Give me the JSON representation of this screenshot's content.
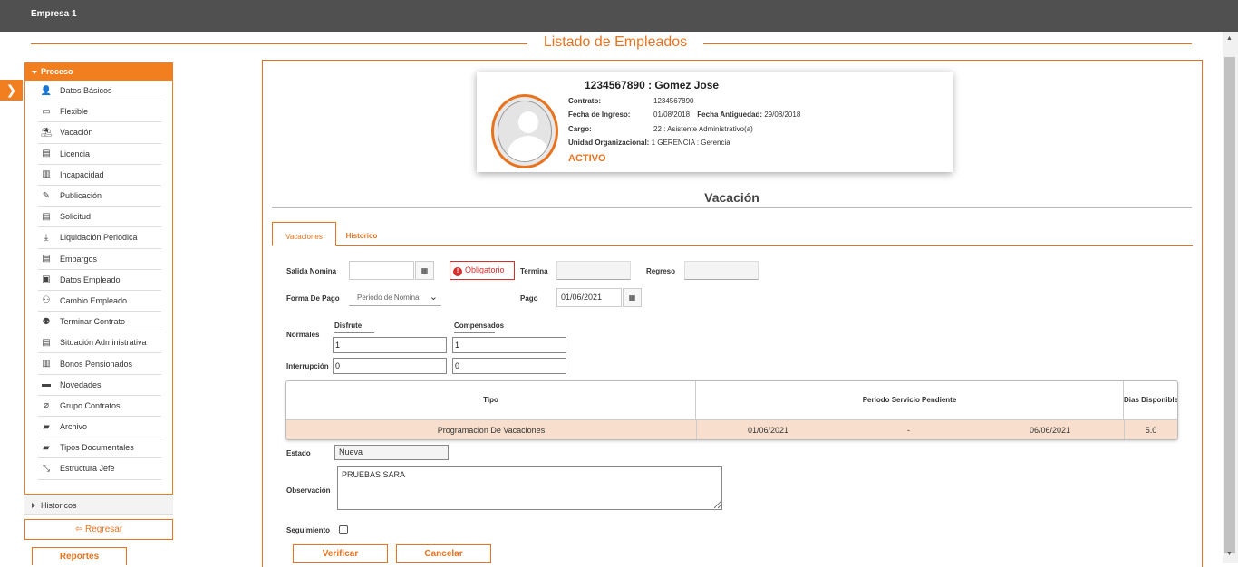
{
  "topbar": {
    "company": "Empresa 1"
  },
  "page": {
    "title": "Listado de Empleados"
  },
  "sidebar": {
    "header": "Proceso",
    "items": [
      {
        "label": "Datos Básicos",
        "icon": "user-icon"
      },
      {
        "label": "Flexible",
        "icon": "money-icon"
      },
      {
        "label": "Vacación",
        "icon": "beach-chair-icon"
      },
      {
        "label": "Licencia",
        "icon": "list-icon"
      },
      {
        "label": "Incapacidad",
        "icon": "book-icon"
      },
      {
        "label": "Publicación",
        "icon": "pencil-icon"
      },
      {
        "label": "Solicitud",
        "icon": "document-icon"
      },
      {
        "label": "Liquidación Periodica",
        "icon": "download-icon"
      },
      {
        "label": "Embargos",
        "icon": "list-icon"
      },
      {
        "label": "Datos Empleado",
        "icon": "id-card-icon"
      },
      {
        "label": "Cambio Empleado",
        "icon": "user-change-icon"
      },
      {
        "label": "Terminar Contrato",
        "icon": "user-remove-icon"
      },
      {
        "label": "Situación Administrativa",
        "icon": "document-icon"
      },
      {
        "label": "Bonos Pensionados",
        "icon": "book-icon"
      },
      {
        "label": "Novedades",
        "icon": "comment-icon"
      },
      {
        "label": "Grupo Contratos",
        "icon": "paperclip-icon"
      },
      {
        "label": "Archivo",
        "icon": "folder-open-icon"
      },
      {
        "label": "Tipos Documentales",
        "icon": "folder-open-icon"
      },
      {
        "label": "Estructura Jefe",
        "icon": "compress-icon"
      }
    ],
    "historicos": "Historicos",
    "regresar": "Regresar",
    "reportes": "Reportes"
  },
  "employee": {
    "title": "1234567890 : Gomez Jose",
    "contrato_label": "Contrato:",
    "contrato": "1234567890",
    "ingreso_label": "Fecha de Ingreso:",
    "ingreso": "01/08/2018",
    "antiguedad_label": "Fecha Antiguedad:",
    "antiguedad": "29/08/2018",
    "cargo_label": "Cargo:",
    "cargo": "22 : Asistente Administrativo(a)",
    "unidad_label": "Unidad Organizacional:",
    "unidad": "1 GERENCIA : Gerencia",
    "status": "ACTIVO"
  },
  "section": {
    "title": "Vacación"
  },
  "tabs": {
    "vacaciones": "Vacaciones",
    "historico": "Historico"
  },
  "form": {
    "salida_label": "Salida Nomina",
    "salida_value": "",
    "obligatorio": "Obligatorio",
    "termina_label": "Termina",
    "termina_value": "",
    "regreso_label": "Regreso",
    "regreso_value": "",
    "forma_pago_label": "Forma De Pago",
    "forma_pago_value": "Periodo de Nomina",
    "pago_label": "Pago",
    "pago_value": "01/06/2021",
    "disfrute_label": "Disfrute",
    "compensados_label": "Compensados",
    "normales_label": "Normales",
    "normales_disfrute": "1",
    "normales_compensados": "1",
    "interrupcion_label": "Interrupción",
    "interrupcion_disfrute": "0",
    "interrupcion_compensados": "0",
    "estado_label": "Estado",
    "estado_value": "Nueva",
    "observacion_label": "Observación",
    "observacion_value": "PRUEBAS SARA",
    "seguimiento_label": "Seguimiento"
  },
  "grid": {
    "headers": {
      "tipo": "Tipo",
      "periodo": "Periodo Servicio Pendiente",
      "dias": "Dias Disponible"
    },
    "row": {
      "tipo": "Programacion De Vacaciones",
      "desde": "01/06/2021",
      "sep": "-",
      "hasta": "06/06/2021",
      "dias": "5.0"
    }
  },
  "buttons": {
    "verificar": "Verificar",
    "cancelar": "Cancelar"
  },
  "colors": {
    "accent": "#e8731f",
    "topbar": "#505050",
    "row_highlight": "#f8dfcd",
    "error": "#d32f2f"
  }
}
